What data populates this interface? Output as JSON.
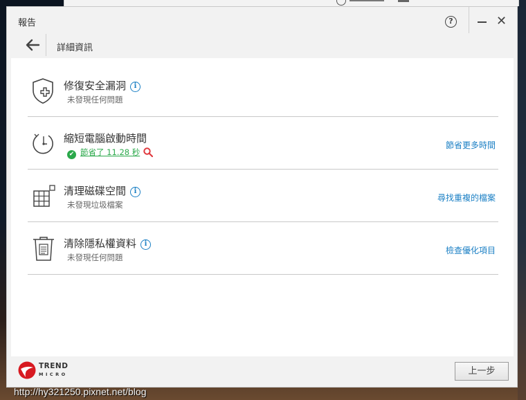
{
  "window": {
    "title": "報告"
  },
  "nav": {
    "breadcrumb": "詳細資訊"
  },
  "rows": [
    {
      "icon": "shield-repair-icon",
      "title": "修復安全漏洞",
      "status": "未發現任何問題",
      "action": ""
    },
    {
      "icon": "clock-startup-icon",
      "title": "縮短電腦啟動時間",
      "status": "節省了 11.28 秒",
      "action": "節省更多時間"
    },
    {
      "icon": "disk-grid-icon",
      "title": "清理磁碟空間",
      "status": "未發現垃圾檔案",
      "action": "尋找重複的檔案"
    },
    {
      "icon": "trash-privacy-icon",
      "title": "清除隱私權資料",
      "status": "未發現任何問題",
      "action": "檢查優化項目"
    }
  ],
  "footer": {
    "brand_line1": "TREND",
    "brand_line2": "MICRO",
    "back_button": "上一步"
  },
  "watermark": "http://hy321250.pixnet.net/blog",
  "colors": {
    "accent": "#1a7fc4",
    "success": "#2aa84a",
    "search_icon": "#e0393e",
    "logo_red": "#d71920"
  }
}
